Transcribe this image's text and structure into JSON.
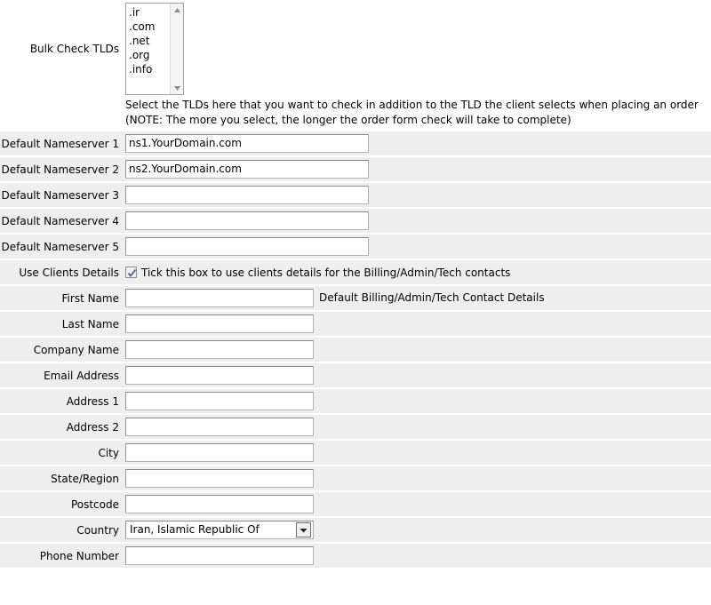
{
  "form": {
    "bulk_check": {
      "label": "Bulk Check TLDs",
      "options": [
        ".ir",
        ".com",
        ".net",
        ".org",
        ".info"
      ],
      "help_line_1": "Select the TLDs here that you want to check in addition to the TLD the client selects when placing an order",
      "help_line_2": "(NOTE: The more you select, the longer the order form check will take to complete)",
      "scroll_up_icon": "scroll-up-arrow-icon",
      "scroll_down_icon": "scroll-down-arrow-icon"
    },
    "nameservers": [
      {
        "label": "Default Nameserver 1",
        "value": "ns1.YourDomain.com"
      },
      {
        "label": "Default Nameserver 2",
        "value": "ns2.YourDomain.com"
      },
      {
        "label": "Default Nameserver 3",
        "value": ""
      },
      {
        "label": "Default Nameserver 4",
        "value": ""
      },
      {
        "label": "Default Nameserver 5",
        "value": ""
      }
    ],
    "use_clients_details": {
      "label": "Use Clients Details",
      "checkbox_label": "Tick this box to use clients details for the Billing/Admin/Tech contacts",
      "checked": true,
      "check_icon": "checkmark-icon"
    },
    "contact_section_note": "Default Billing/Admin/Tech Contact Details",
    "contact_fields": [
      {
        "label": "First Name",
        "value": ""
      },
      {
        "label": "Last Name",
        "value": ""
      },
      {
        "label": "Company Name",
        "value": ""
      },
      {
        "label": "Email Address",
        "value": ""
      },
      {
        "label": "Address 1",
        "value": ""
      },
      {
        "label": "Address 2",
        "value": ""
      },
      {
        "label": "City",
        "value": ""
      },
      {
        "label": "State/Region",
        "value": ""
      },
      {
        "label": "Postcode",
        "value": ""
      }
    ],
    "country": {
      "label": "Country",
      "value": "Iran, Islamic Republic Of",
      "dropdown_icon": "chevron-down-icon"
    },
    "phone": {
      "label": "Phone Number",
      "value": ""
    }
  },
  "colors": {
    "row_background": "#eeeeee",
    "page_background": "#ffffff",
    "input_border": "#b4b4b4",
    "check_color": "#4a6a9a"
  }
}
